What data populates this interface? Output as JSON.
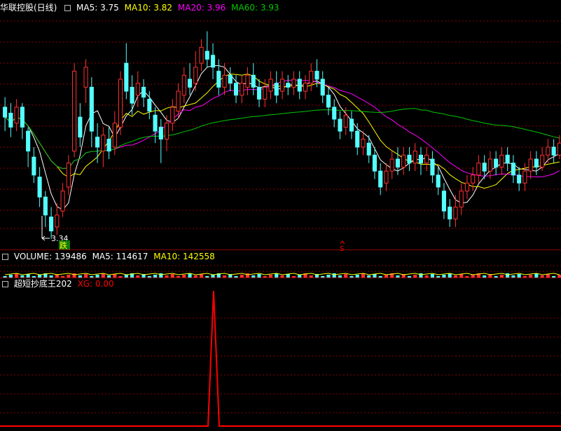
{
  "panes": {
    "price": {
      "title": "华联控股(日线)",
      "ma5_label": "MA5: 3.75",
      "ma10_label": "MA10: 3.82",
      "ma20_label": "MA20: 3.96",
      "ma60_label": "MA60: 3.93",
      "low_marker": "3.34",
      "signal_die": "跌",
      "signal_s": "S"
    },
    "volume": {
      "volume_label": "VOLUME: 139486",
      "ma5_label": "MA5: 114617",
      "ma10_label": "MA10: 142558"
    },
    "indicator": {
      "name": "超短抄底王202",
      "xg_label": "XG: 0.00"
    }
  },
  "colors": {
    "background": "#000000",
    "grid": "#8b0000",
    "up": "#ff3232",
    "down": "#54ffff",
    "ma5": "#ffffff",
    "ma10": "#ffff00",
    "ma20": "#ff00ff",
    "ma60": "#00c800",
    "signal": "#ff0000"
  },
  "chart_data": {
    "type": "candlestick",
    "price_low_marker": 3.34,
    "ma_values": {
      "MA5": 3.75,
      "MA10": 3.82,
      "MA20": 3.96,
      "MA60": 3.93
    },
    "volume_values": {
      "VOLUME": 139486,
      "MA5": 114617,
      "MA10": 142558
    },
    "indicator_xg": 0.0,
    "indicator_xg_peak": 1
  }
}
